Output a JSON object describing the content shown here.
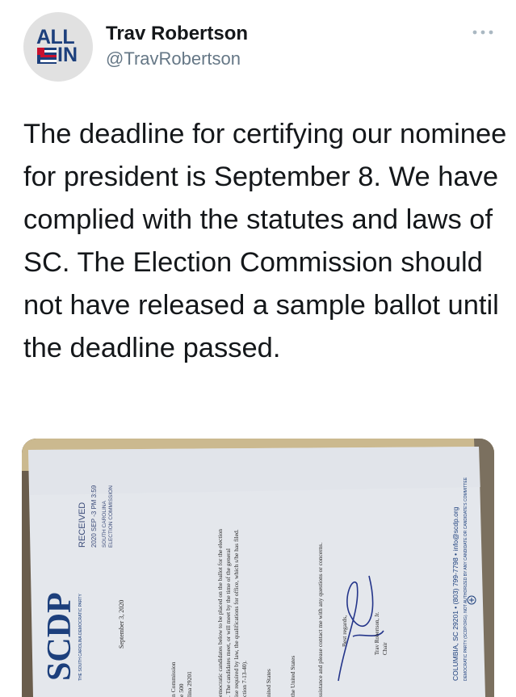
{
  "tweet": {
    "author_name": "Trav Robertson",
    "author_handle": "@TravRobertson",
    "avatar": {
      "line1": "ALL",
      "line2": "IN"
    },
    "more_icon": "more-horizontal-icon",
    "text": "The deadline for certifying our nominee for president is September 8. We have complied with the statutes and laws of SC. The Election Commission should not have released a sample ballot until the deadline passed."
  },
  "document": {
    "logo": "SCDP",
    "party_caption": "THE SOUTH CAROLINA DEMOCRATIC PARTY",
    "stamp": {
      "received": "RECEIVED",
      "datetime": "2020 SEP -3 PM 3:59",
      "agency_line1": "SOUTH CAROLINA",
      "agency_line2": "ELECTION COMMISSION"
    },
    "date": "September 3, 2020",
    "address_lines": [
      "n Commission",
      "e 500",
      "lina 29201"
    ],
    "body_lines": [
      "emocratic candidates below to be placed on the ballot for the election",
      ". The candidates meet, or will meet by the time of the general",
      "ise required by law, the qualifications for office, which s/he has filed.",
      "ction 7-13-40)."
    ],
    "list_lines": [
      "nited States",
      "the United States"
    ],
    "closing": "ssistance and please contact me with any questions or concerns.",
    "signoff": "Best regards,",
    "signer_name": "Trav Robertson, Jr.",
    "signer_title": "Chair",
    "footer_contact": "COLUMBIA, SC 29201  •  (803) 799-7798  •  info@scdp.org",
    "footer_disclaimer": "DEMOCRATIC PARTY (SCDP.ORG). NOT AUTHORIZED BY ANY CANDIDATE OR CANDIDATE'S COMMITTEE"
  },
  "colors": {
    "text": "#14171a",
    "secondary": "#657786",
    "brand_blue": "#1c3f7c",
    "brand_red": "#c8102e"
  }
}
